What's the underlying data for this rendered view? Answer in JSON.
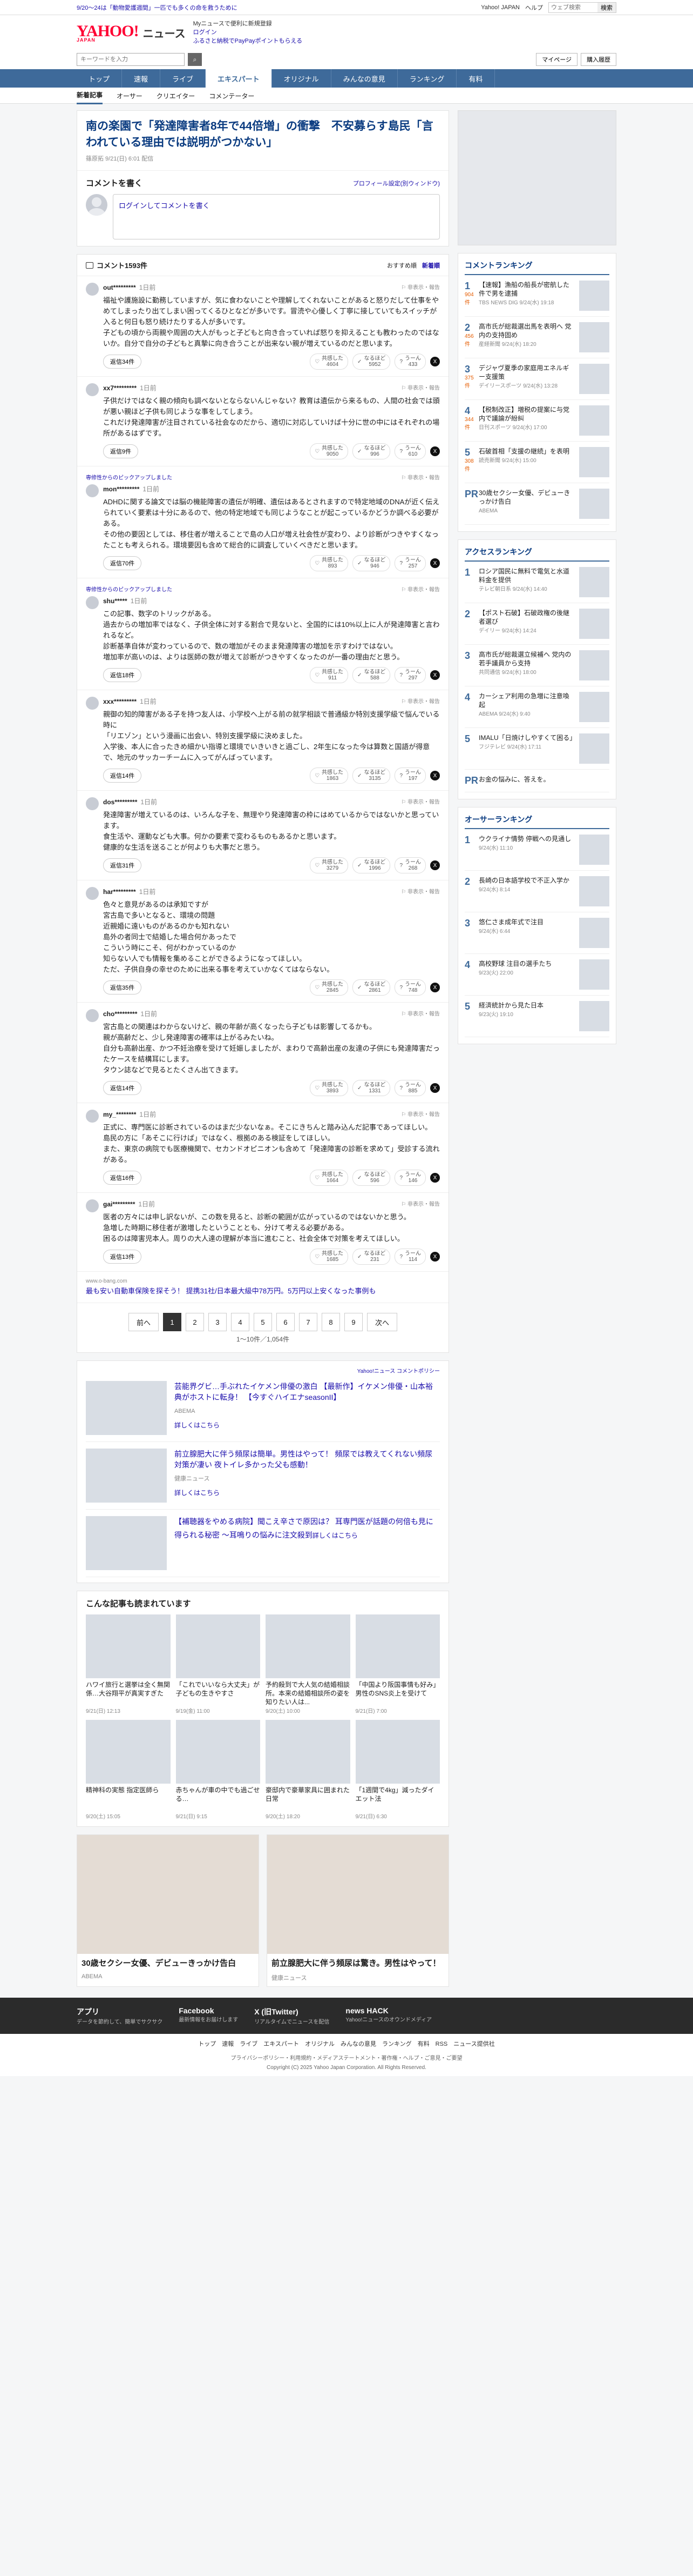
{
  "topbar": {
    "notice": "9/20～24は「動物愛護週間」一匹でも多くの命を救うために",
    "search_placeholder": "ウェブ検索",
    "search_btn": "検索",
    "links": [
      "Yahoo! JAPAN",
      "ヘルプ"
    ]
  },
  "header": {
    "logo": "YAHOO!",
    "logo_sub": "JAPAN",
    "service": "ニュース",
    "p1": "ログイン",
    "p2": "ふるさと納税でPayPayポイントもらえる",
    "p3": "Myニュースで便利に新規登録"
  },
  "searchrow": {
    "placeholder": "キーワードを入力",
    "mypage": "マイページ",
    "purchase": "購入履歴"
  },
  "nav": {
    "items": [
      "トップ",
      "速報",
      "ライブ",
      "エキスパート",
      "オリジナル",
      "みんなの意見",
      "ランキング",
      "有料"
    ],
    "active": 3
  },
  "subnav": {
    "items": [
      "新着記事",
      "オーサー",
      "クリエイター",
      "コメンテーター"
    ],
    "active": 0
  },
  "article": {
    "title": "南の楽園で「発達障害者8年で44倍増」の衝撃　不安募らす島民「言われている理由では説明がつかない」",
    "meta": "篠原拓 9/21(日) 6:01 配信"
  },
  "comment_write": {
    "heading": "コメントを書く",
    "policy": "プロフィール設定(別ウィンドウ)",
    "placeholder": "ログインしてコメントを書く"
  },
  "comments_head": {
    "title": "コメント1593件",
    "sort": [
      "おすすめ順",
      "新着順"
    ]
  },
  "comments": [
    {
      "name": "out*********",
      "time": "1日前",
      "pin": "",
      "text": "福祉や護施設に勤務していますが、気に食わないことや理解してくれないことがあると怒りだして仕事をやめてしまったり出てしまい困ってくるひとなどが多いです。冒涜や心優しく丁寧に接していてもスイッチが入ると何日も怒り続けたりする人が多いです。\n子どもの頃から両親や周囲の大人がもっと子どもと向き合っていれば怒りを抑えることも教わったのではないか。自分で自分の子どもと真摯に向き合うことが出来ない親が増えているのだと思います。",
      "reply": "返信34件",
      "votes": [
        [
          "共感した",
          "4604"
        ],
        [
          "なるほど",
          "5952"
        ],
        [
          "うーん",
          "433"
        ]
      ]
    },
    {
      "name": "xx7*********",
      "time": "1日前",
      "pin": "",
      "text": "子供だけではなく親の傾向も調べないとならないんじゃない？教育は遺伝から来るもの、人間の社会では頭が悪い親ほど子供も同じような事をしてしまう。\nこれだけ発達障害が注目されている社会なのだから、適切に対応していけば十分に世の中にはそれぞれの場所があるはずです。",
      "reply": "返信9件",
      "votes": [
        [
          "共感した",
          "9050"
        ],
        [
          "なるほど",
          "996"
        ],
        [
          "うーん",
          "610"
        ]
      ]
    },
    {
      "name": "mon*********",
      "time": "1日前",
      "pin": "専修性からのピックアップしました",
      "text": "ADHDに関する論文では脳の機能障害の遺伝が明確、遺伝はあるとされますので特定地域のDNAが近く伝えられていく要素は十分にあるので、他の特定地域でも同じようなことが起こっているかどうか調べる必要がある。\nその他の要因としては、移住者が増えることで島の人口が増え社会性が変わり、より診断がつきやすくなったことも考えられる。環境要因も含めて総合的に調査していくべきだと思います。",
      "reply": "返信70件",
      "votes": [
        [
          "共感した",
          "893"
        ],
        [
          "なるほど",
          "946"
        ],
        [
          "うーん",
          "257"
        ]
      ]
    },
    {
      "name": "shu*****",
      "time": "1日前",
      "pin": "専修性からのピックアップしました",
      "text": "この記事、数字のトリックがある。\n過去からの増加率ではなく、子供全体に対する割合で見ないと、全国的には10%以上に人が発達障害と言われるなど。\n診断基準自体が変わっているので、数の増加がそのまま発達障害の増加を示すわけではない。\n増加率が高いのは、よりは医師の数が増えて診断がつきやすくなったのが一番の理由だと思う。",
      "reply": "返信18件",
      "votes": [
        [
          "共感した",
          "911"
        ],
        [
          "なるほど",
          "588"
        ],
        [
          "うーん",
          "297"
        ]
      ]
    },
    {
      "name": "xxx*********",
      "time": "1日前",
      "pin": "",
      "text": "親御の知的障害がある子を持つ友人は、小学校へ上がる前の就学相談で普通級か特別支援学級で悩んでいる時に\n「リエゾン」という漫画に出会い、特別支援学級に決めました。\n入学後、本人に合ったきめ細かい指導と環境でいきいきと過ごし、2年生になった今は算数と国語が得意で、地元のサッカーチームに入ってがんばっています。",
      "reply": "返信14件",
      "votes": [
        [
          "共感した",
          "1863"
        ],
        [
          "なるほど",
          "3135"
        ],
        [
          "うーん",
          "197"
        ]
      ]
    },
    {
      "name": "dos*********",
      "time": "1日前",
      "pin": "",
      "text": "発達障害が増えているのは、いろんな子を、無理やり発達障害の枠にはめているからではないかと思っています。\n食生活や、運動なども大事。何かの要素で変わるものもあるかと思います。\n健康的な生活を送ることが何よりも大事だと思う。",
      "reply": "返信31件",
      "votes": [
        [
          "共感した",
          "3279"
        ],
        [
          "なるほど",
          "1996"
        ],
        [
          "うーん",
          "268"
        ]
      ]
    },
    {
      "name": "har*********",
      "time": "1日前",
      "pin": "",
      "text": "色々と意見があるのは承知ですが\n宮古島で多いとなると、環境の問題\n近親婚に遠いものがあるのかも知れない\n島外の者同士で結婚した場合何かあったで\nこういう時にこそ、何がわかっているのか\n知らない人でも情報を集めることができるようになってほしい。\nただ、子供自身の幸せのために出来る事を考えていかなくてはならない。",
      "reply": "返信35件",
      "votes": [
        [
          "共感した",
          "2845"
        ],
        [
          "なるほど",
          "2861"
        ],
        [
          "うーん",
          "748"
        ]
      ]
    },
    {
      "name": "cho*********",
      "time": "1日前",
      "pin": "",
      "text": "宮古島との関連はわからないけど、親の年齢が高くなったら子どもは影響してるかも。\n親が高齢だと、少し発達障害の確率は上がるみたいね。\n自分も高齢出産、かつ不妊治療を受けて妊娠しましたが、まわりで高齢出産の友達の子供にも発達障害だったケースを結構耳にします。\nタウン誌などで見るとたくさん出てきます。",
      "reply": "返信14件",
      "votes": [
        [
          "共感した",
          "3893"
        ],
        [
          "なるほど",
          "1331"
        ],
        [
          "うーん",
          "885"
        ]
      ]
    },
    {
      "name": "my_********",
      "time": "1日前",
      "pin": "",
      "text": "正式に、専門医に診断されているのはまだ少ないなぁ。そこにきちんと踏み込んだ記事であってほしい。\n島民の方に「あそこに行けば」ではなく、根拠のある検証をしてほしい。\nまた、東京の病院でも医療機関で、セカンドオピニオンも含めて「発達障害の診断を求めて」受診する流れがある。",
      "reply": "返信16件",
      "votes": [
        [
          "共感した",
          "1664"
        ],
        [
          "なるほど",
          "596"
        ],
        [
          "うーん",
          "146"
        ]
      ]
    },
    {
      "name": "gai*********",
      "time": "1日前",
      "pin": "",
      "text": "医者の方々には申し訳ないが、この数を見ると、診断の範囲が広がっているのではないかと思う。\n急増した時期に移住者が激増したということとも、分けて考える必要がある。\n困るのは障害児本人。周りの大人達の理解が本当に進むこと、社会全体で対策を考えてほしい。",
      "reply": "返信13件",
      "votes": [
        [
          "共感した",
          "1685"
        ],
        [
          "なるほど",
          "231"
        ],
        [
          "うーん",
          "114"
        ]
      ]
    }
  ],
  "inline_ad": {
    "url": "www.o-bang.com",
    "text": "最も安い自動車保険を探そう！ 提携31社/日本最大級中78万円。5万円以上安くなった事例も"
  },
  "pager": {
    "prev": "前へ",
    "pages": [
      "1",
      "2",
      "3",
      "4",
      "5",
      "6",
      "7",
      "8",
      "9"
    ],
    "next": "次へ",
    "active": 0,
    "count": "1〜10件／1,054件"
  },
  "ad_caption": "Yahoo!ニュース コメントポリシー",
  "ads": [
    {
      "title": "芸能界グビ…手ぶれたイケメン俳優の激白 【最新作】イケメン俳優・山本裕典がホストに転身！ 【今すぐハイエナseasonII】",
      "src": "ABEMA",
      "more": "詳しくはこちら"
    },
    {
      "title": "前立腺肥大に伴う頻尿は簡単。男性はやって！ 頻尿では教えてくれない頻尿対策が凄い 夜トイレ多かった父も感動！",
      "src": "健康ニュース",
      "more": "詳しくはこちら"
    },
    {
      "title": "【補聴器をやめる病院】聞こえ辛さで原因は？ 耳専門医が話題の何倍も見に得られる秘密 ～耳鳴りの悩みに注文殺到",
      "src": "",
      "more": "詳しくはこちら"
    }
  ],
  "also": {
    "heading": "こんな記事も読まれています",
    "items": [
      {
        "t": "ハワイ旅行と選挙は全く無関係…大谷翔平が真実すぎた",
        "s": "9/21(日) 12:13"
      },
      {
        "t": "「これでいいなら大丈夫」が子どもの生きやすさ",
        "s": "9/19(金) 11:00"
      },
      {
        "t": "予約殺到で大人気の結婚相談所。本来の結婚相談所の姿を知りたい人は...",
        "s": "9/20(土) 10:00"
      },
      {
        "t": "「中国より阪国事情も好み」男性のSNS炎上を受けて",
        "s": "9/21(日) 7:00"
      },
      {
        "t": "精神科の実態 指定医師ら",
        "s": "9/20(土) 15:05"
      },
      {
        "t": "赤ちゃんが車の中でも過ごせる…",
        "s": "9/21(日) 9:15"
      },
      {
        "t": "豪邸内で豪華家具に囲まれた日常",
        "s": "9/20(土) 18:20"
      },
      {
        "t": "「1週間で4kg」減ったダイエット法",
        "s": "9/21(日) 6:30"
      }
    ]
  },
  "bigads": [
    {
      "t": "30歳セクシー女優、デビューきっかけ告白",
      "s": "ABEMA"
    },
    {
      "t": "前立腺肥大に伴う頻尿は驚き。男性はやって！",
      "s": "健康ニュース"
    }
  ],
  "ranking": {
    "heading": "コメントランキング",
    "items": [
      {
        "n": "1",
        "c": "904件",
        "t": "【速報】漁船の船長が密航した件で男を逮捕",
        "s": "TBS NEWS DIG 9/24(水) 19:18"
      },
      {
        "n": "2",
        "c": "456件",
        "t": "高市氏が総裁選出馬を表明へ 党内の支持固め",
        "s": "産経新聞 9/24(水) 18:20"
      },
      {
        "n": "3",
        "c": "375件",
        "t": "デジャヴ夏季の家庭用エネルギー支援策",
        "s": "デイリースポーツ 9/24(水) 13:28"
      },
      {
        "n": "4",
        "c": "344件",
        "t": "【税制改正】増税の提案に与党内で議論が紛糾",
        "s": "日刊スポーツ 9/24(水) 17:00"
      },
      {
        "n": "5",
        "c": "308件",
        "t": "石破首相「支援の継続」を表明",
        "s": "読売新聞 9/24(水) 15:00"
      }
    ]
  },
  "ranking_pr": {
    "t": "30歳セクシー女優、デビューきっかけ告白",
    "s": "ABEMA"
  },
  "access": {
    "heading": "アクセスランキング",
    "items": [
      {
        "n": "1",
        "t": "ロシア国民に無料で電気と水道料金を提供",
        "s": "テレビ朝日系 9/24(水) 14:40"
      },
      {
        "n": "2",
        "t": "【ポスト石破】石破政権の後継者選び",
        "s": "デイリー 9/24(水) 14:24"
      },
      {
        "n": "3",
        "t": "高市氏が総裁選立候補へ 党内の若手議員から支持",
        "s": "共同通信 9/24(水) 18:00"
      },
      {
        "n": "4",
        "t": "カーシェア利用の急増に注意喚起",
        "s": "ABEMA 9/24(水) 9:40"
      },
      {
        "n": "5",
        "t": "IMALU「日焼けしやすくて困る」",
        "s": "フジテレビ 9/24(水) 17:11"
      }
    ]
  },
  "pr_small": "お金の悩みに、答えを。",
  "author": {
    "heading": "オーサーランキング",
    "items": [
      {
        "n": "1",
        "t": "ウクライナ情勢 停戦への見通し",
        "s": "9/24(水) 11:10"
      },
      {
        "n": "2",
        "t": "長崎の日本語学校で不正入学か",
        "s": "9/24(水) 8:14"
      },
      {
        "n": "3",
        "t": "悠仁さま成年式で注目",
        "s": "9/24(水) 6:44"
      },
      {
        "n": "4",
        "t": "高校野球 注目の選手たち",
        "s": "9/23(火) 22:00"
      },
      {
        "n": "5",
        "t": "経済統計から見た日本",
        "s": "9/23(火) 19:10"
      }
    ]
  },
  "footer": {
    "items": [
      [
        "アプリ",
        "データを節約して、簡単でサクサク"
      ],
      [
        "Facebook",
        "最新情報をお届けします"
      ],
      [
        "X (旧Twitter)",
        "リアルタイムでニュースを配信"
      ],
      [
        "news HACK",
        "Yahoo!ニュースのオウンドメディア"
      ]
    ],
    "nav": "トップ　速報　ライブ　エキスパート　オリジナル　みんなの意見　ランキング　有料　RSS　ニュース提供社",
    "nav2": "プライバシーポリシー・利用規約・メディアステートメント・著作権・ヘルプ・ご意見・ご要望",
    "copy": "Copyright (C) 2025 Yahoo Japan Corporation. All Rights Reserved."
  }
}
